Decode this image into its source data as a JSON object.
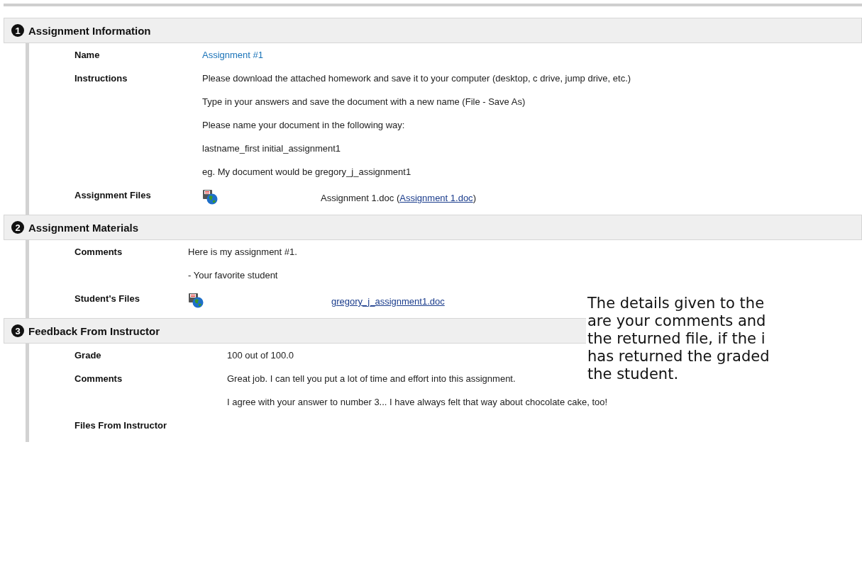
{
  "sections": [
    {
      "number": "1",
      "title": "Assignment Information",
      "rows": [
        {
          "label": "Name",
          "kind": "link",
          "lines": [
            "Assignment #1"
          ]
        },
        {
          "label": "Instructions",
          "kind": "text",
          "lines": [
            "Please download the attached homework and save it to your computer (desktop, c drive, jump drive, etc.)",
            "Type in your answers and save the document with a new name (File - Save As)",
            "Please name your document in the following way:",
            "lastname_first initial_assignment1",
            "eg. My document would be gregory_j_assignment1"
          ]
        },
        {
          "label": "Assignment Files",
          "kind": "file",
          "file": {
            "prefix": "Assignment 1.doc (",
            "link": "Assignment 1.doc",
            "suffix": ")"
          }
        }
      ]
    },
    {
      "number": "2",
      "title": "Assignment Materials",
      "rows": [
        {
          "label": "Comments",
          "kind": "text",
          "lines": [
            "Here is my assignment #1.",
            "- Your favorite student"
          ]
        },
        {
          "label": "Student's Files",
          "kind": "file",
          "file": {
            "link": "gregory_j_assignment1.doc"
          }
        }
      ]
    },
    {
      "number": "3",
      "title": "Feedback From Instructor",
      "rows": [
        {
          "label": "Grade",
          "kind": "text",
          "lines": [
            "100 out of 100.0"
          ]
        },
        {
          "label": "Comments",
          "kind": "text",
          "lines": [
            "Great job. I can tell you put a lot of time and effort into this assignment.",
            "I agree with your answer to number 3... I have always felt that way about chocolate cake, too!"
          ]
        },
        {
          "label": "Files From Instructor",
          "kind": "empty"
        }
      ]
    }
  ],
  "callout": {
    "lines": [
      "The details given to the",
      "are your comments and",
      "the returned file, if the i",
      "has returned the graded",
      "the student."
    ]
  }
}
